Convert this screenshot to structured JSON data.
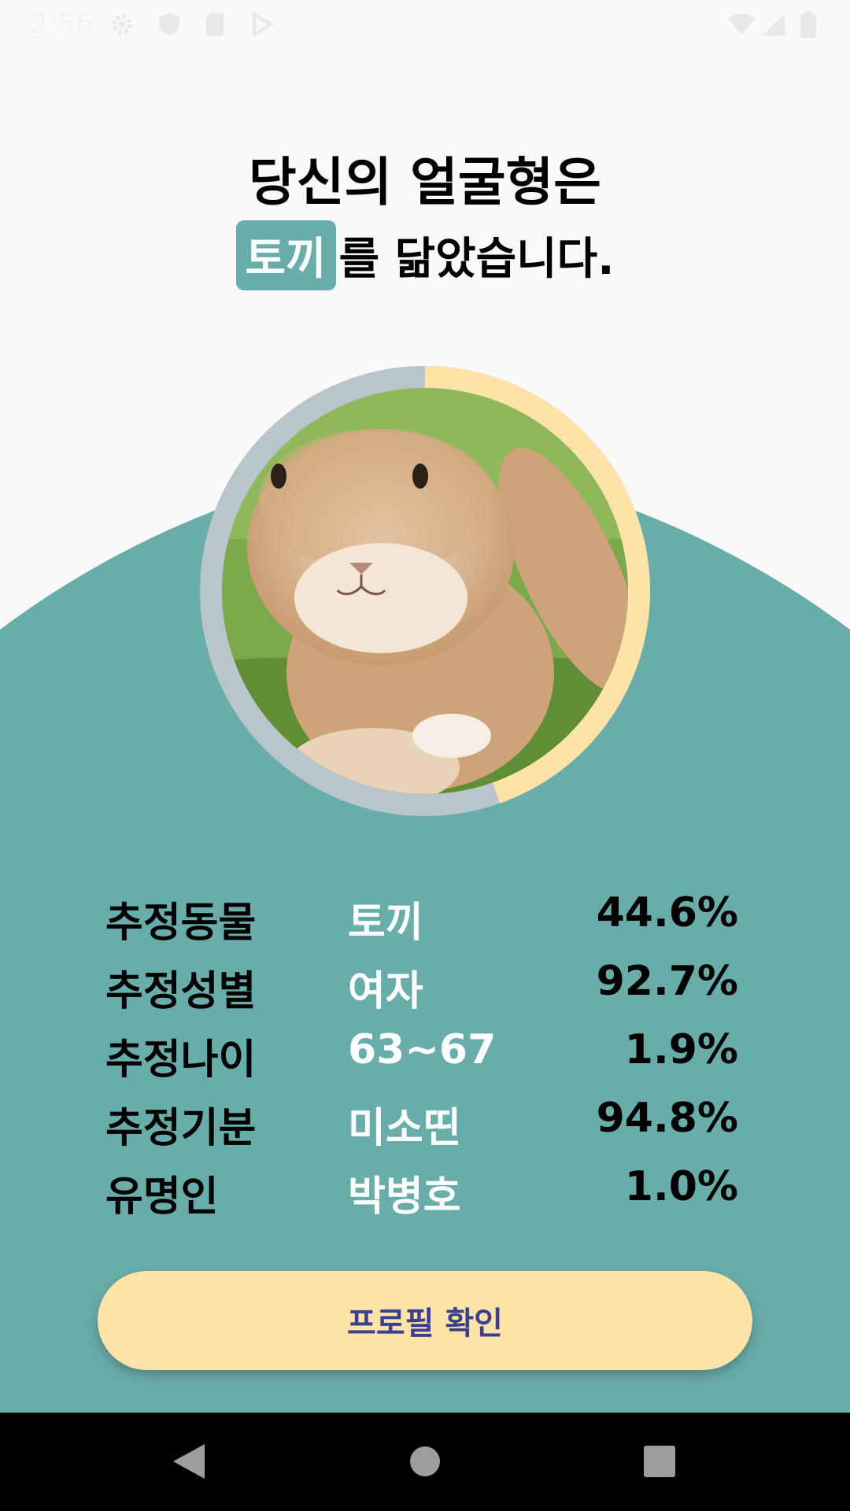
{
  "status_bar": {
    "time": "2:56",
    "icons": [
      "gear-icon",
      "shield-icon",
      "sd-card-icon",
      "play-icon",
      "wifi-icon",
      "signal-icon",
      "battery-icon"
    ]
  },
  "header": {
    "line1": "당신의 얼굴형은",
    "animal": "토끼",
    "line2_rest": "를 닮았습니다."
  },
  "ring": {
    "match_percent": 44.6,
    "fill_color": "#fde3a7",
    "track_color": "#b8c6cb"
  },
  "stats": [
    {
      "label": "추정동물",
      "value": "토끼",
      "percent": "44.6%"
    },
    {
      "label": "추정성별",
      "value": "여자",
      "percent": "92.7%"
    },
    {
      "label": "추정나이",
      "value": "63~67",
      "percent": "1.9%"
    },
    {
      "label": "추정기분",
      "value": "미소띤",
      "percent": "94.8%"
    },
    {
      "label": "유명인",
      "value": "박병호",
      "percent": "1.0%"
    }
  ],
  "profile_button": {
    "label": "프로필 확인"
  },
  "colors": {
    "teal": "#69adaa",
    "button": "#fde3a7",
    "button_text": "#3b3f8e"
  },
  "nav_bar": {
    "icons": [
      "back-icon",
      "home-icon",
      "recents-icon"
    ]
  }
}
